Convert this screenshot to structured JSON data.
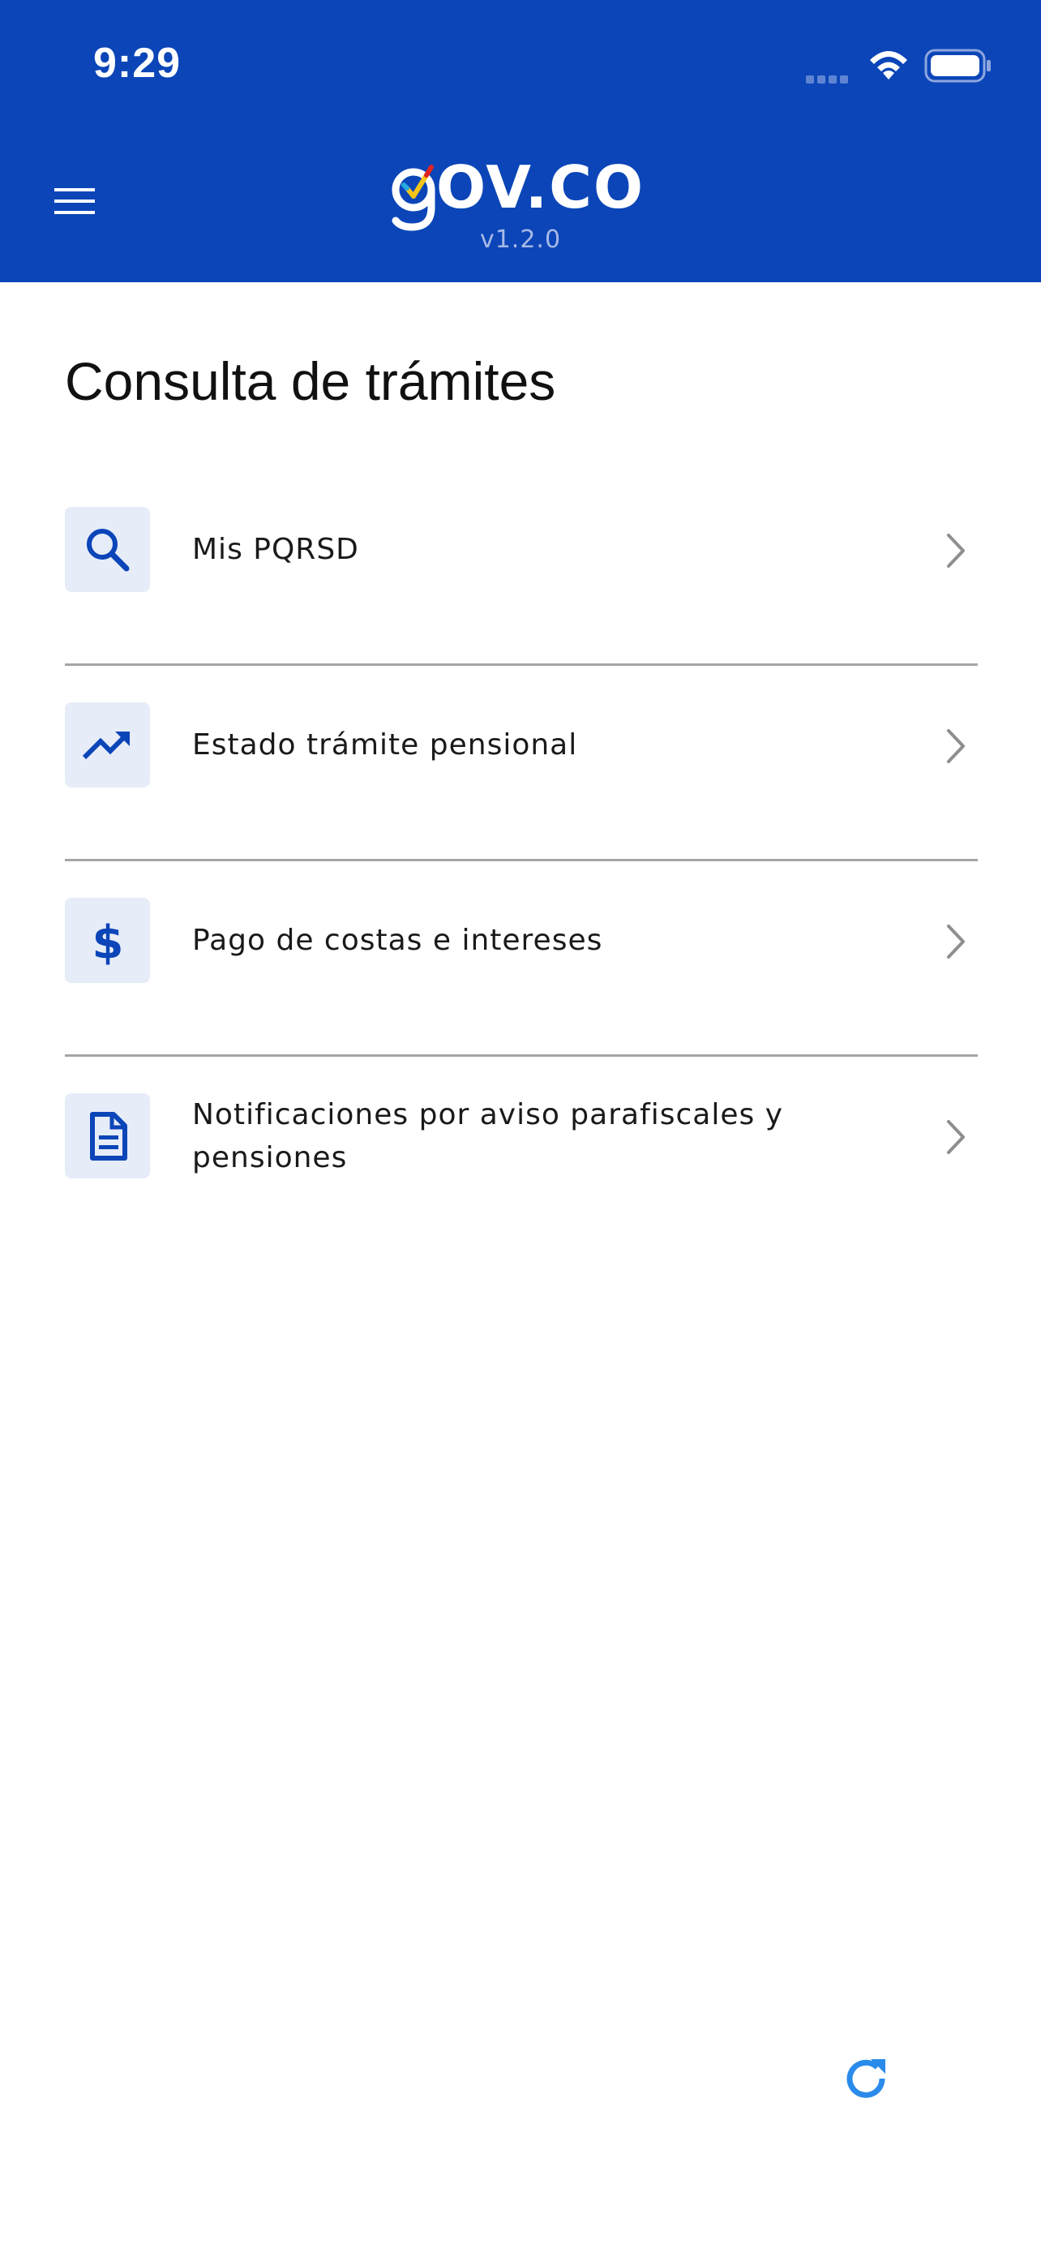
{
  "status_bar": {
    "time": "9:29"
  },
  "header": {
    "logo_text": "OV.CO",
    "version": "v1.2.0"
  },
  "page": {
    "title": "Consulta de trámites"
  },
  "items": [
    {
      "label": "Mis PQRSD",
      "icon": "search-icon"
    },
    {
      "label": "Estado trámite pensional",
      "icon": "trending-up-icon"
    },
    {
      "label": "Pago de costas e intereses",
      "icon": "dollar-icon"
    },
    {
      "label": "Notificaciones por aviso parafiscales y pensiones",
      "icon": "document-icon"
    }
  ],
  "colors": {
    "header_bg": "#0b45b8",
    "icon_blue": "#0b45b8",
    "icon_bg": "#e6ecf8",
    "refresh_blue": "#2a8bea",
    "chevron": "#8e8e8e"
  }
}
